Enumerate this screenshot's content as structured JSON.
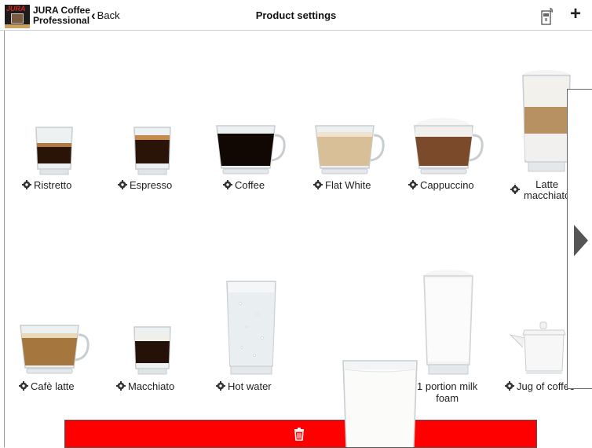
{
  "app": {
    "name_line1": "JURA Coffee",
    "name_line2": "Professional",
    "logo_brand": "JURA"
  },
  "header": {
    "back_label": "Back",
    "title": "Product settings"
  },
  "products": {
    "ristretto": "Ristretto",
    "espresso": "Espresso",
    "coffee": "Coffee",
    "flat_white": "Flat White",
    "cappuccino": "Cappuccino",
    "latte_line1": "Latte",
    "latte_line2": "macchiato",
    "cafe_latte": "Cafè latte",
    "macchiato": "Macchiato",
    "hot_water": "Hot water",
    "milk_foam_line1": "1 portion milk",
    "milk_foam_line2": "foam",
    "jug": "Jug of coffee"
  },
  "icons": {
    "gear": "gear-icon",
    "back": "chevron-left-icon",
    "machine": "coffee-machine-icon",
    "add": "plus-icon",
    "next": "chevron-right-icon",
    "delete": "trash-icon"
  },
  "colors": {
    "delete_bar": "#ff0000",
    "header_border": "#cfcfcf",
    "text": "#222222"
  }
}
